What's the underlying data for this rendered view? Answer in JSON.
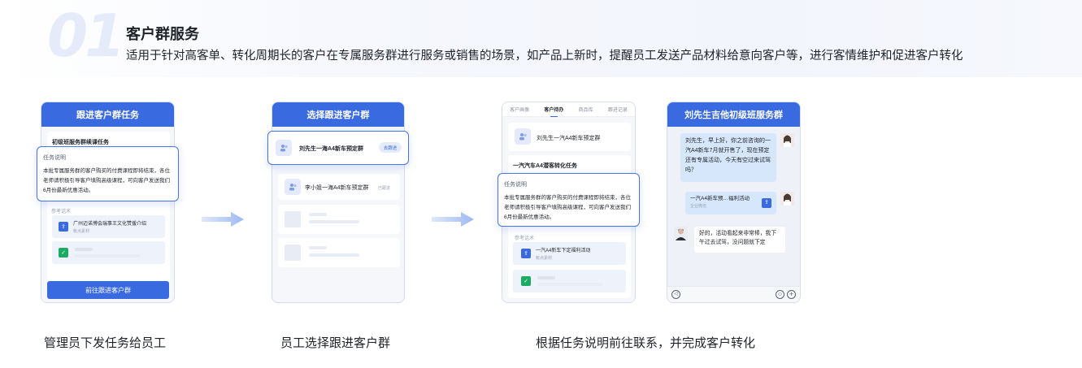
{
  "hero": {
    "number": "01",
    "title": "客户群服务",
    "description": "适用于针对高客单、转化周期长的客户在专属服务群进行服务或销售的场景，如产品上新时，提醒员工发送产品材料给意向客户等，进行客情维护和促进客户转化"
  },
  "panel1": {
    "header": "跟进客户群任务",
    "task_name": "初级班服务群续课任务",
    "popup_title": "任务说明",
    "popup_body": "本批专属服务群的客户购买的付费课程即将结束，各位老师请积极引导客户填购高级课程，可向客户发送我们6月份最新优惠活动。",
    "ref_label": "参考话术",
    "ref_item": "广州迈诺博会瑞事王文化赞援介绍",
    "ref_item_sub": "帐点素材",
    "button": "前往跟进客户群"
  },
  "panel2": {
    "header": "选择跟进客户群",
    "group1": "刘先生一海A4新车预定群",
    "group1_action": "去跟进",
    "group2": "李小姐一海A4新车预定群",
    "group2_status": "已跟进"
  },
  "panel3": {
    "tabs": [
      "客户画像",
      "客户待办",
      "商品库",
      "跟进记录"
    ],
    "group": "刘先生一汽A4新车预定群",
    "task_name": "一汽汽车A4潜客转化任务",
    "popup_title": "任务说明",
    "popup_body": "本批专属服务群的客户购买的付费课程即将结束，各位老师请积极引导客户填购高级课程，可向客户发送我们6月份最新优惠活动。",
    "ref_label": "参考话术",
    "ref_item": "一汽A4新车下定福利活动",
    "ref_item_sub": "帐点素材"
  },
  "panel4": {
    "header": "刘先生吉他初级班服务群",
    "msg1": "刘先生，早上好，你之前咨询的一汽A4新车7月就开售了，现在预定还有专属活动，今天有空过来试驾吗？",
    "msg2": "一汽A4新车预…福利活动",
    "msg2_sub": "企业微信",
    "msg3": "好的，活动看起来非常棒，我下午过去试驾，没问题就下定"
  },
  "captions": {
    "step1": "管理员下发任务给员工",
    "step2": "员工选择跟进客户群",
    "step3": "根据任务说明前往联系，并完成客户转化"
  },
  "colors": {
    "primary": "#3a6ae0",
    "arrow": "#a9c1f5"
  }
}
